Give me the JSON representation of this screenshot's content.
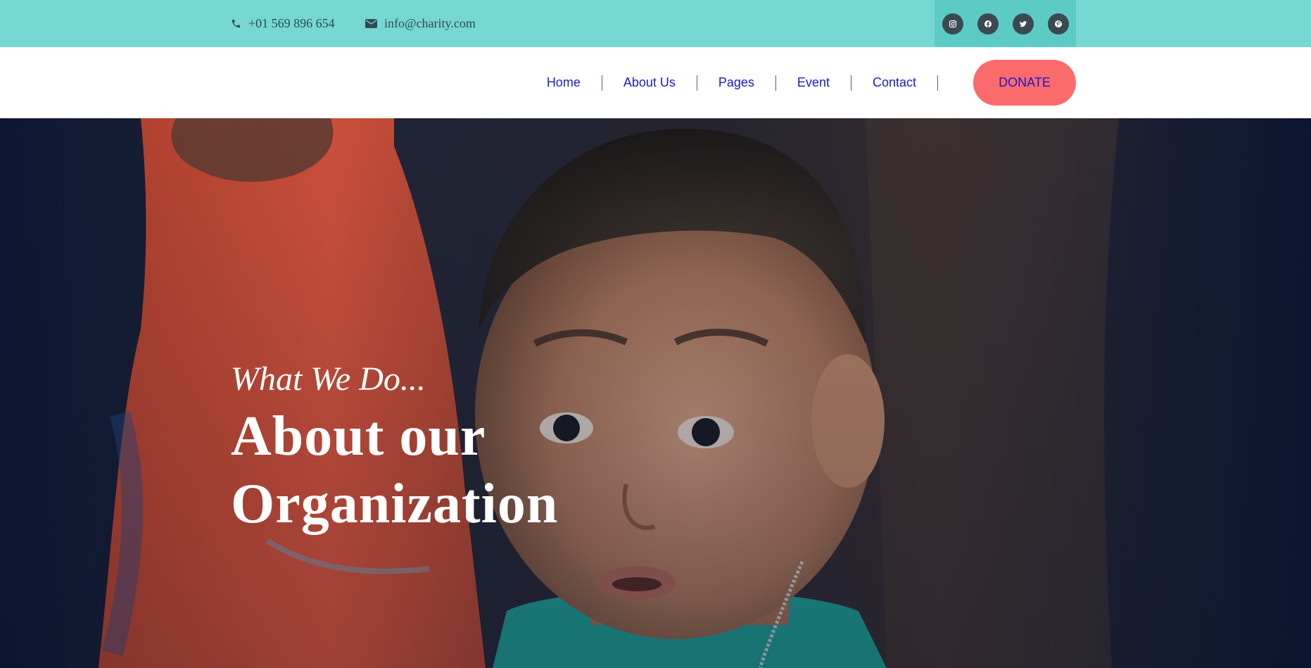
{
  "topbar": {
    "phone": "+01 569 896 654",
    "email": "info@charity.com",
    "phone_icon": "phone-icon",
    "email_icon": "mail-icon",
    "social_icons": [
      "instagram-icon",
      "facebook-icon",
      "twitter-icon",
      "pinterest-icon"
    ]
  },
  "nav": {
    "items": [
      "Home",
      "About Us",
      "Pages",
      "Event",
      "Contact"
    ],
    "donate": "DONATE"
  },
  "hero": {
    "subtitle": "What We Do...",
    "title_line1": "About our",
    "title_line2": "Organization"
  },
  "colors": {
    "topbar": "#76d7d3",
    "social_bg": "#5ccbc6",
    "donate": "#fc6b6c",
    "nav_link": "#1a18c8"
  }
}
